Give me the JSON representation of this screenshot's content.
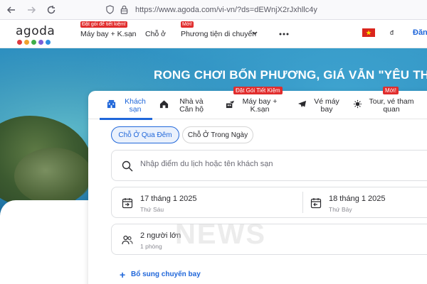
{
  "browser": {
    "url": "https://www.agoda.com/vi-vn/?ds=dEWnjX2rJxhllc4y"
  },
  "header": {
    "logo_text": "agoda",
    "logo_colors": [
      "#e03a3e",
      "#f0a22e",
      "#3fae49",
      "#7a5ed8",
      "#2e8ee0"
    ],
    "nav": [
      {
        "label": "Máy bay + K.sạn",
        "badge": "Đặt gói để tiết kiệm!"
      },
      {
        "label": "Chỗ ở",
        "badge": ""
      },
      {
        "label": "Phương tiện di chuyển",
        "badge": "Mới!"
      }
    ],
    "currency": "đ",
    "signin": "Đăng"
  },
  "hero": {
    "title": "RONG CHƠI BỐN PHƯƠNG, GIÁ VẪN \"YÊU THƯƠ"
  },
  "search": {
    "tabs": [
      {
        "label": "Khách sạn",
        "active": true,
        "badge": "",
        "icon": "hotel-icon"
      },
      {
        "label": "Nhà và Căn hộ",
        "active": false,
        "badge": "",
        "icon": "home-icon"
      },
      {
        "label": "Máy bay + K.sạn",
        "active": false,
        "badge": "Đặt Gói Tiết Kiệm",
        "icon": "flight-hotel-icon"
      },
      {
        "label": "Vé máy bay",
        "active": false,
        "badge": "",
        "icon": "airplane-icon"
      },
      {
        "label": "Tour, vé tham quan",
        "active": false,
        "badge": "Mới!",
        "icon": "tour-icon"
      }
    ],
    "stay_types": [
      "Chỗ Ở Qua Đêm",
      "Chỗ Ở Trong Ngày"
    ],
    "destination_placeholder": "Nhập điểm du lịch hoặc tên khách sạn",
    "checkin": {
      "date": "17 tháng 1 2025",
      "day": "Thứ Sáu"
    },
    "checkout": {
      "date": "18 tháng 1 2025",
      "day": "Thứ Bảy"
    },
    "guests": {
      "main": "2 người lớn",
      "sub": "1 phòng"
    },
    "add_flight": "Bổ sung chuyến bay"
  },
  "colors": {
    "accent": "#2067da",
    "badge": "#e12d2d"
  },
  "watermark": "NEWS"
}
